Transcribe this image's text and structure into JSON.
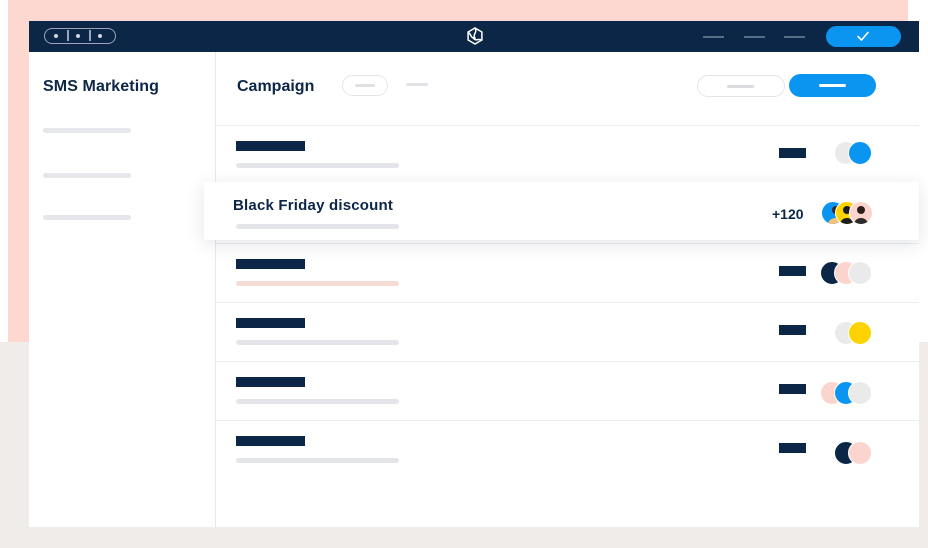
{
  "app": {
    "window_title": "",
    "brand_icon": "hexagon-swirl-logo-icon",
    "confirm_icon": "checkmark-icon"
  },
  "sidebar": {
    "title": "SMS Marketing",
    "items": [
      {
        "label": ""
      },
      {
        "label": ""
      },
      {
        "label": ""
      }
    ]
  },
  "main": {
    "header": {
      "title": "Campaign",
      "filter_label": "",
      "secondary_button_label": "",
      "primary_button_label": ""
    },
    "featured_campaign": {
      "name": "Black Friday discount",
      "recipients_count": "+120"
    },
    "campaign_rows": [
      {
        "name": "",
        "metric": "",
        "avatars": [
          "gray",
          "blue"
        ]
      },
      {
        "name": "",
        "metric": "",
        "avatars": [
          "navy",
          "pink",
          "gray"
        ]
      },
      {
        "name": "",
        "metric": "",
        "avatars": [
          "gray",
          "yellow"
        ]
      },
      {
        "name": "",
        "metric": "",
        "avatars": [
          "pink",
          "blue",
          "gray"
        ]
      },
      {
        "name": "",
        "metric": "",
        "avatars": [
          "navy",
          "pink"
        ]
      }
    ]
  },
  "colors": {
    "navy": "#0b2646",
    "accent_blue": "#0a96f0",
    "peach": "#fdd8d0",
    "pink": "#fbd5cd",
    "yellow": "#ffd300",
    "light_gray": "#eaeaea"
  }
}
